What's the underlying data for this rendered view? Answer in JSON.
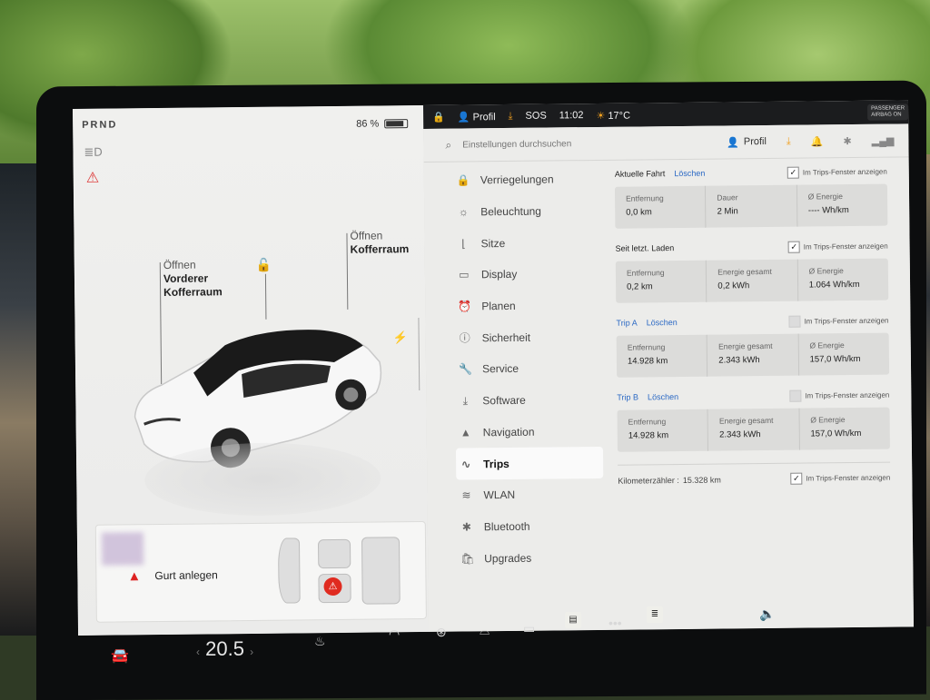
{
  "status": {
    "gears": "PRND",
    "battery_percent": "86 %",
    "battery_level": 0.86
  },
  "left_panel": {
    "open_front": [
      "Öffnen",
      "Vorderer",
      "Kofferraum"
    ],
    "open_trunk": [
      "Öffnen",
      "Kofferraum"
    ],
    "belt_notice": "Gurt anlegen"
  },
  "topbar": {
    "profile": "Profil",
    "sos": "SOS",
    "time": "11:02",
    "temperature": "17°C",
    "airbag": [
      "PASSENGER",
      "AIRBAG ON"
    ]
  },
  "search": {
    "placeholder": "Einstellungen durchsuchen",
    "profile": "Profil"
  },
  "nav": [
    {
      "label": "Verriegelungen",
      "icon": "lock-icon"
    },
    {
      "label": "Beleuchtung",
      "icon": "sun-icon"
    },
    {
      "label": "Sitze",
      "icon": "seat-icon"
    },
    {
      "label": "Display",
      "icon": "display-icon"
    },
    {
      "label": "Planen",
      "icon": "alarm-clock-icon"
    },
    {
      "label": "Sicherheit",
      "icon": "info-circle-icon"
    },
    {
      "label": "Service",
      "icon": "wrench-icon"
    },
    {
      "label": "Software",
      "icon": "download-icon"
    },
    {
      "label": "Navigation",
      "icon": "navigation-arrow-icon"
    },
    {
      "label": "Trips",
      "icon": "trips-icon",
      "active": true
    },
    {
      "label": "WLAN",
      "icon": "wifi-icon"
    },
    {
      "label": "Bluetooth",
      "icon": "bluetooth-icon"
    },
    {
      "label": "Upgrades",
      "icon": "shopping-bag-icon"
    }
  ],
  "trips": {
    "current": {
      "title": "Aktuelle Fahrt",
      "delete": "Löschen",
      "show_label": "Im Trips-Fenster anzeigen",
      "checked": true,
      "stats": [
        {
          "k": "Entfernung",
          "v": "0,0 km"
        },
        {
          "k": "Dauer",
          "v": "2 Min"
        },
        {
          "k": "Ø Energie",
          "v": "---- Wh/km"
        }
      ]
    },
    "since_charge": {
      "title": "Seit letzt. Laden",
      "show_label": "Im Trips-Fenster anzeigen",
      "checked": true,
      "stats": [
        {
          "k": "Entfernung",
          "v": "0,2 km"
        },
        {
          "k": "Energie gesamt",
          "v": "0,2 kWh"
        },
        {
          "k": "Ø Energie",
          "v": "1.064 Wh/km"
        }
      ]
    },
    "trip_a": {
      "title": "Trip A",
      "delete": "Löschen",
      "show_label": "Im Trips-Fenster anzeigen",
      "checked": false,
      "stats": [
        {
          "k": "Entfernung",
          "v": "14.928 km"
        },
        {
          "k": "Energie gesamt",
          "v": "2.343 kWh"
        },
        {
          "k": "Ø Energie",
          "v": "157,0 Wh/km"
        }
      ]
    },
    "trip_b": {
      "title": "Trip B",
      "delete": "Löschen",
      "show_label": "Im Trips-Fenster anzeigen",
      "checked": false,
      "stats": [
        {
          "k": "Entfernung",
          "v": "14.928 km"
        },
        {
          "k": "Energie gesamt",
          "v": "2.343 kWh"
        },
        {
          "k": "Ø Energie",
          "v": "157,0 Wh/km"
        }
      ]
    },
    "odometer": {
      "label": "Kilometerzähler :",
      "value": "15.328 km",
      "show_label": "Im Trips-Fenster anzeigen",
      "checked": true
    }
  },
  "dock": {
    "temperature": "20.5"
  }
}
